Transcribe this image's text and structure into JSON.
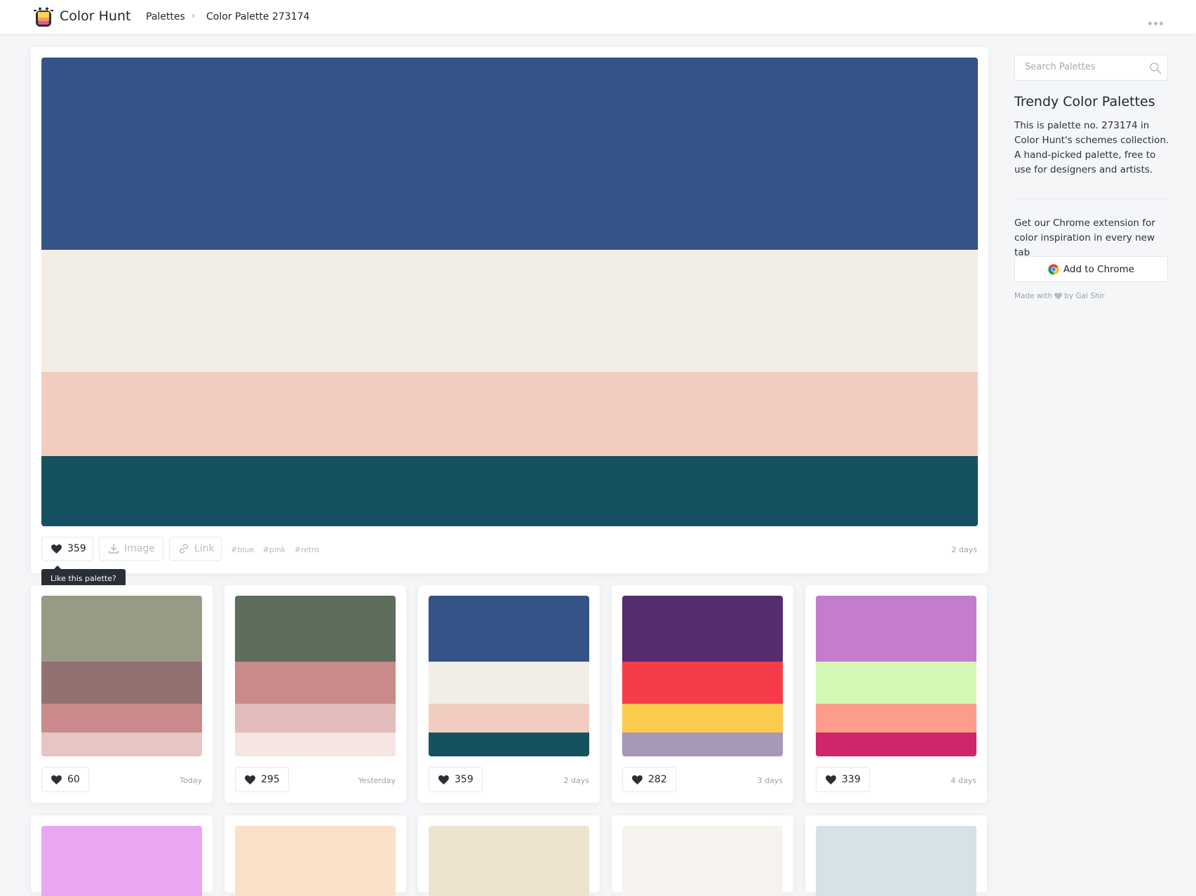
{
  "header": {
    "brand": "Color Hunt",
    "breadcrumb": {
      "root": "Palettes",
      "separator": "›",
      "current": "Color Palette 273174"
    }
  },
  "main_palette": {
    "colors": [
      "#345387",
      "#f3ede8",
      "#f2cdbf",
      "#165161"
    ],
    "likes": "359",
    "image_label": "Image",
    "link_label": "Link",
    "tags": [
      "#blue",
      "#pink",
      "#retro"
    ],
    "date": "2 days",
    "tooltip": "Like this palette?"
  },
  "sidebar": {
    "search_placeholder": "Search Palettes",
    "title": "Trendy Color Palettes",
    "description": "This is palette no. 273174 in Color Hunt's schemes collection. A hand-picked palette, free to use for designers and artists.",
    "extension_text": "Get our Chrome extension for color inspiration in every new tab",
    "chrome_button": "Add to Chrome",
    "credit_prefix": "Made with",
    "credit_suffix": "by Gal Shir"
  },
  "palettes": [
    {
      "colors": [
        "#999a85",
        "#947071",
        "#ca8a8b",
        "#e7c5c2"
      ],
      "likes": "60",
      "date": "Today"
    },
    {
      "colors": [
        "#5e6e5c",
        "#ca8a8b",
        "#e3bdbb",
        "#f6e5e2"
      ],
      "likes": "295",
      "date": "Yesterday"
    },
    {
      "colors": [
        "#345387",
        "#f3ede8",
        "#f2cdbf",
        "#165161"
      ],
      "likes": "359",
      "date": "2 days"
    },
    {
      "colors": [
        "#562d6e",
        "#f73c49",
        "#fccb4c",
        "#a698b6"
      ],
      "likes": "282",
      "date": "3 days"
    },
    {
      "colors": [
        "#c47ccd",
        "#d5f8b7",
        "#fc9d8c",
        "#cf256b"
      ],
      "likes": "339",
      "date": "4 days"
    }
  ],
  "more_palettes": [
    "#e9a6f1",
    "#fae0c8",
    "#eee3cf",
    "#f6f3ee",
    "#d6e2e7"
  ]
}
